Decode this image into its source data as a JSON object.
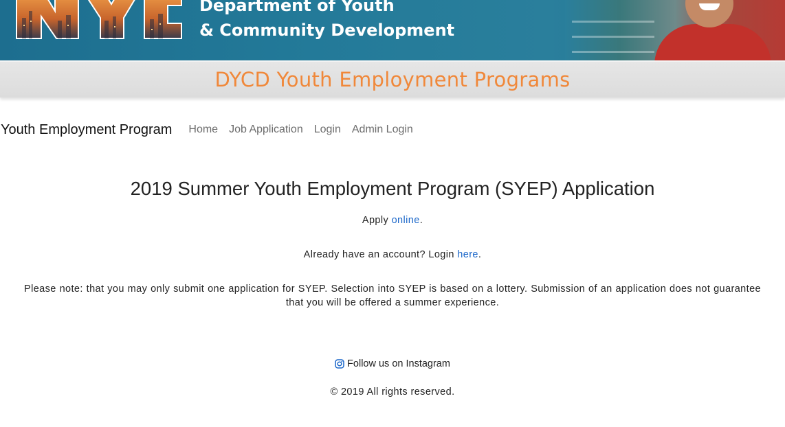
{
  "banner": {
    "logo_text": "NYC",
    "agency_line1": "Department of Youth",
    "agency_line2": "& Community Development",
    "program_heading": "DYCD Youth Employment Programs"
  },
  "navbar": {
    "brand": "Youth Employment Program",
    "links": [
      {
        "label": "Home"
      },
      {
        "label": "Job Application"
      },
      {
        "label": "Login"
      },
      {
        "label": "Admin Login"
      }
    ]
  },
  "main": {
    "title": "2019 Summer Youth Employment Program (SYEP) Application",
    "apply_prefix": "Apply ",
    "apply_link": "online",
    "apply_suffix": ".",
    "account_prefix": "Already have an account? Login ",
    "account_link": "here",
    "account_suffix": ".",
    "note": "Please note: that you may only submit one application for SYEP. Selection into SYEP is based on a lottery. Submission of an application does not guarantee that you will be offered a summer experience."
  },
  "footer": {
    "instagram_icon": "instagram-icon",
    "instagram_label": "Follow us on Instagram",
    "copyright": "© 2019 All rights reserved."
  },
  "colors": {
    "banner_blue": "#237a99",
    "heading_orange": "#f0883a",
    "link_blue": "#1a66c9"
  }
}
